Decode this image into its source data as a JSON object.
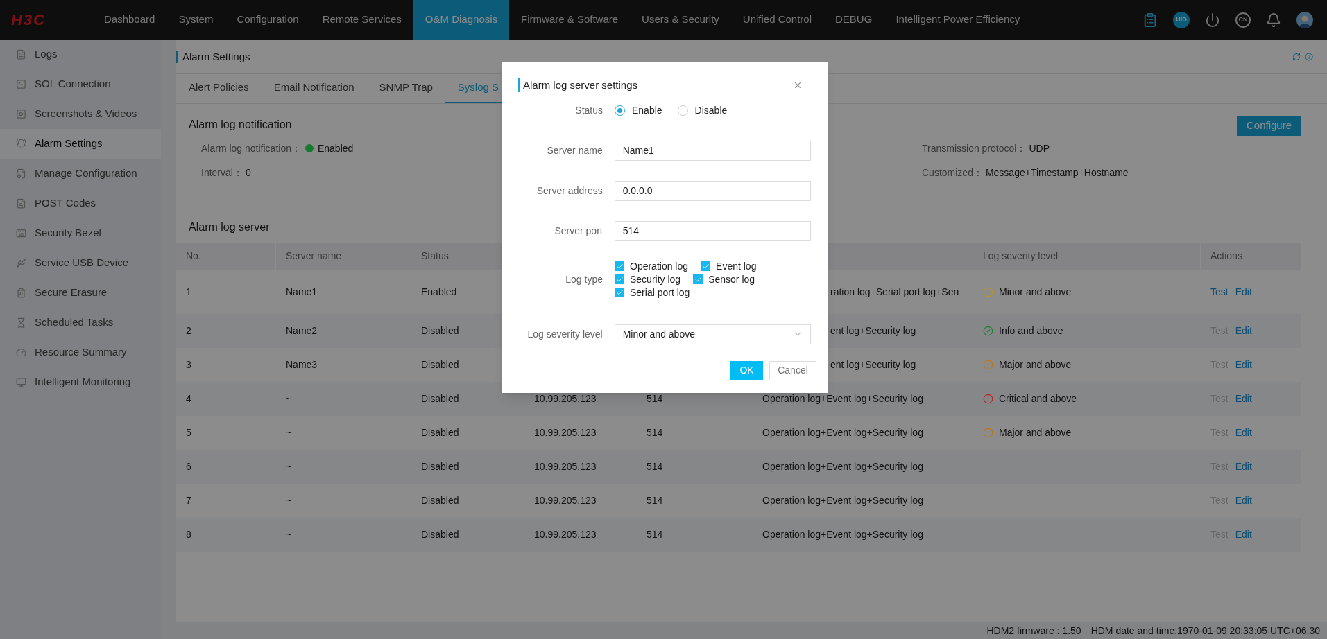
{
  "topbar": {
    "logo": "H3C",
    "nav": [
      {
        "label": "Dashboard",
        "selected": false
      },
      {
        "label": "System",
        "selected": false
      },
      {
        "label": "Configuration",
        "selected": false
      },
      {
        "label": "Remote Services",
        "selected": false
      },
      {
        "label": "O&M Diagnosis",
        "selected": true
      },
      {
        "label": "Firmware & Software",
        "selected": false
      },
      {
        "label": "Users & Security",
        "selected": false
      },
      {
        "label": "Unified Control",
        "selected": false
      },
      {
        "label": "DEBUG",
        "selected": false
      },
      {
        "label": "Intelligent Power Efficiency",
        "selected": false
      }
    ],
    "uid_badge": "UID",
    "language_badge": "CN"
  },
  "sidebar": {
    "items": [
      {
        "label": "Logs",
        "selected": false
      },
      {
        "label": "SOL Connection",
        "selected": false
      },
      {
        "label": "Screenshots & Videos",
        "selected": false
      },
      {
        "label": "Alarm Settings",
        "selected": true
      },
      {
        "label": "Manage Configuration",
        "selected": false
      },
      {
        "label": "POST Codes",
        "selected": false
      },
      {
        "label": "Security Bezel",
        "selected": false
      },
      {
        "label": "Service USB Device",
        "selected": false
      },
      {
        "label": "Secure Erasure",
        "selected": false
      },
      {
        "label": "Scheduled Tasks",
        "selected": false
      },
      {
        "label": "Resource Summary",
        "selected": false
      },
      {
        "label": "Intelligent Monitoring",
        "selected": false
      }
    ]
  },
  "page": {
    "title": "Alarm Settings",
    "tabs": [
      {
        "label": "Alert Policies",
        "selected": false
      },
      {
        "label": "Email Notification",
        "selected": false
      },
      {
        "label": "SNMP Trap",
        "selected": false
      },
      {
        "label": "Syslog S",
        "selected": true
      }
    ]
  },
  "notification": {
    "title": "Alarm log notification",
    "configure_button": "Configure",
    "status_label": "Alarm log notification：",
    "status": {
      "value": "Enabled",
      "color": "#157a2e"
    },
    "interval_label": "Interval：",
    "interval_value": "0",
    "protocol_label": "Transmission protocol：",
    "protocol_value": "UDP",
    "customized_label": "Customized：",
    "customized_value": "Message+Timestamp+Hostname"
  },
  "server_table": {
    "title": "Alarm log server",
    "columns_left": [
      "No.",
      "Server name",
      "Status"
    ],
    "columns_right": [
      "Log severity level",
      "Actions"
    ],
    "rows": [
      {
        "no": "1",
        "name": "Name1",
        "status": "Enabled",
        "log_type": "ration log+Serial port log+Sen",
        "severity": {
          "label": "Minor and above",
          "kind": "alert",
          "color": "#b8912a"
        },
        "actions": [
          {
            "label": "Test",
            "disabled": false
          },
          {
            "label": "Edit",
            "disabled": false
          }
        ]
      },
      {
        "no": "2",
        "name": "Name2",
        "status": "Disabled",
        "log_type": "ent log+Security log",
        "severity": {
          "label": "Info and above",
          "kind": "check",
          "color": "#1f7f35"
        },
        "actions": [
          {
            "label": "Test",
            "disabled": true
          },
          {
            "label": "Edit",
            "disabled": false
          }
        ]
      },
      {
        "no": "3",
        "name": "Name3",
        "status": "Disabled",
        "log_type": "ent log+Security log",
        "severity": {
          "label": "Major and above",
          "kind": "alert",
          "color": "#c07518"
        },
        "actions": [
          {
            "label": "Test",
            "disabled": true
          },
          {
            "label": "Edit",
            "disabled": false
          }
        ]
      },
      {
        "no": "4",
        "name": "~",
        "status": "Disabled",
        "address": "10.99.205.123",
        "port": "514",
        "log_type": "Operation log+Event log+Security log",
        "severity": {
          "label": "Critical and above",
          "kind": "alert",
          "color": "#b8262c"
        },
        "actions": [
          {
            "label": "Test",
            "disabled": true
          },
          {
            "label": "Edit",
            "disabled": false
          }
        ]
      },
      {
        "no": "5",
        "name": "~",
        "status": "Disabled",
        "address": "10.99.205.123",
        "port": "514",
        "log_type": "Operation log+Event log+Security log",
        "severity": {
          "label": "Major and above",
          "kind": "alert",
          "color": "#c07518"
        },
        "actions": [
          {
            "label": "Test",
            "disabled": true
          },
          {
            "label": "Edit",
            "disabled": false
          }
        ]
      },
      {
        "no": "6",
        "name": "~",
        "status": "Disabled",
        "address": "10.99.205.123",
        "port": "514",
        "log_type": "Operation log+Event log+Security log",
        "actions": [
          {
            "label": "Test",
            "disabled": true
          },
          {
            "label": "Edit",
            "disabled": false
          }
        ]
      },
      {
        "no": "7",
        "name": "~",
        "status": "Disabled",
        "address": "10.99.205.123",
        "port": "514",
        "log_type": "Operation log+Event log+Security log",
        "actions": [
          {
            "label": "Test",
            "disabled": true
          },
          {
            "label": "Edit",
            "disabled": false
          }
        ]
      },
      {
        "no": "8",
        "name": "~",
        "status": "Disabled",
        "address": "10.99.205.123",
        "port": "514",
        "log_type": "Operation log+Event log+Security log",
        "actions": [
          {
            "label": "Test",
            "disabled": true
          },
          {
            "label": "Edit",
            "disabled": false
          }
        ]
      }
    ]
  },
  "status_bar": {
    "firmware": "HDM2 firmware : 1.50",
    "datetime": "HDM date and time:1970-01-09 20:33:05 UTC+06:30"
  },
  "dialog": {
    "title": "Alarm log server settings",
    "status_label": "Status",
    "status_options": [
      {
        "label": "Enable",
        "selected": true
      },
      {
        "label": "Disable",
        "selected": false
      }
    ],
    "fields": [
      {
        "label": "Server name",
        "value": "Name1"
      },
      {
        "label": "Server address",
        "value": "0.0.0.0"
      },
      {
        "label": "Server port",
        "value": "514"
      }
    ],
    "log_type_label": "Log type",
    "log_types": [
      {
        "label": "Operation log",
        "checked": true
      },
      {
        "label": "Event log",
        "checked": true
      },
      {
        "label": "Security log",
        "checked": true
      },
      {
        "label": "Sensor log",
        "checked": true
      },
      {
        "label": "Serial port log",
        "checked": true
      }
    ],
    "severity_label": "Log severity level",
    "severity_value": "Minor and above",
    "ok": "OK",
    "cancel": "Cancel"
  }
}
